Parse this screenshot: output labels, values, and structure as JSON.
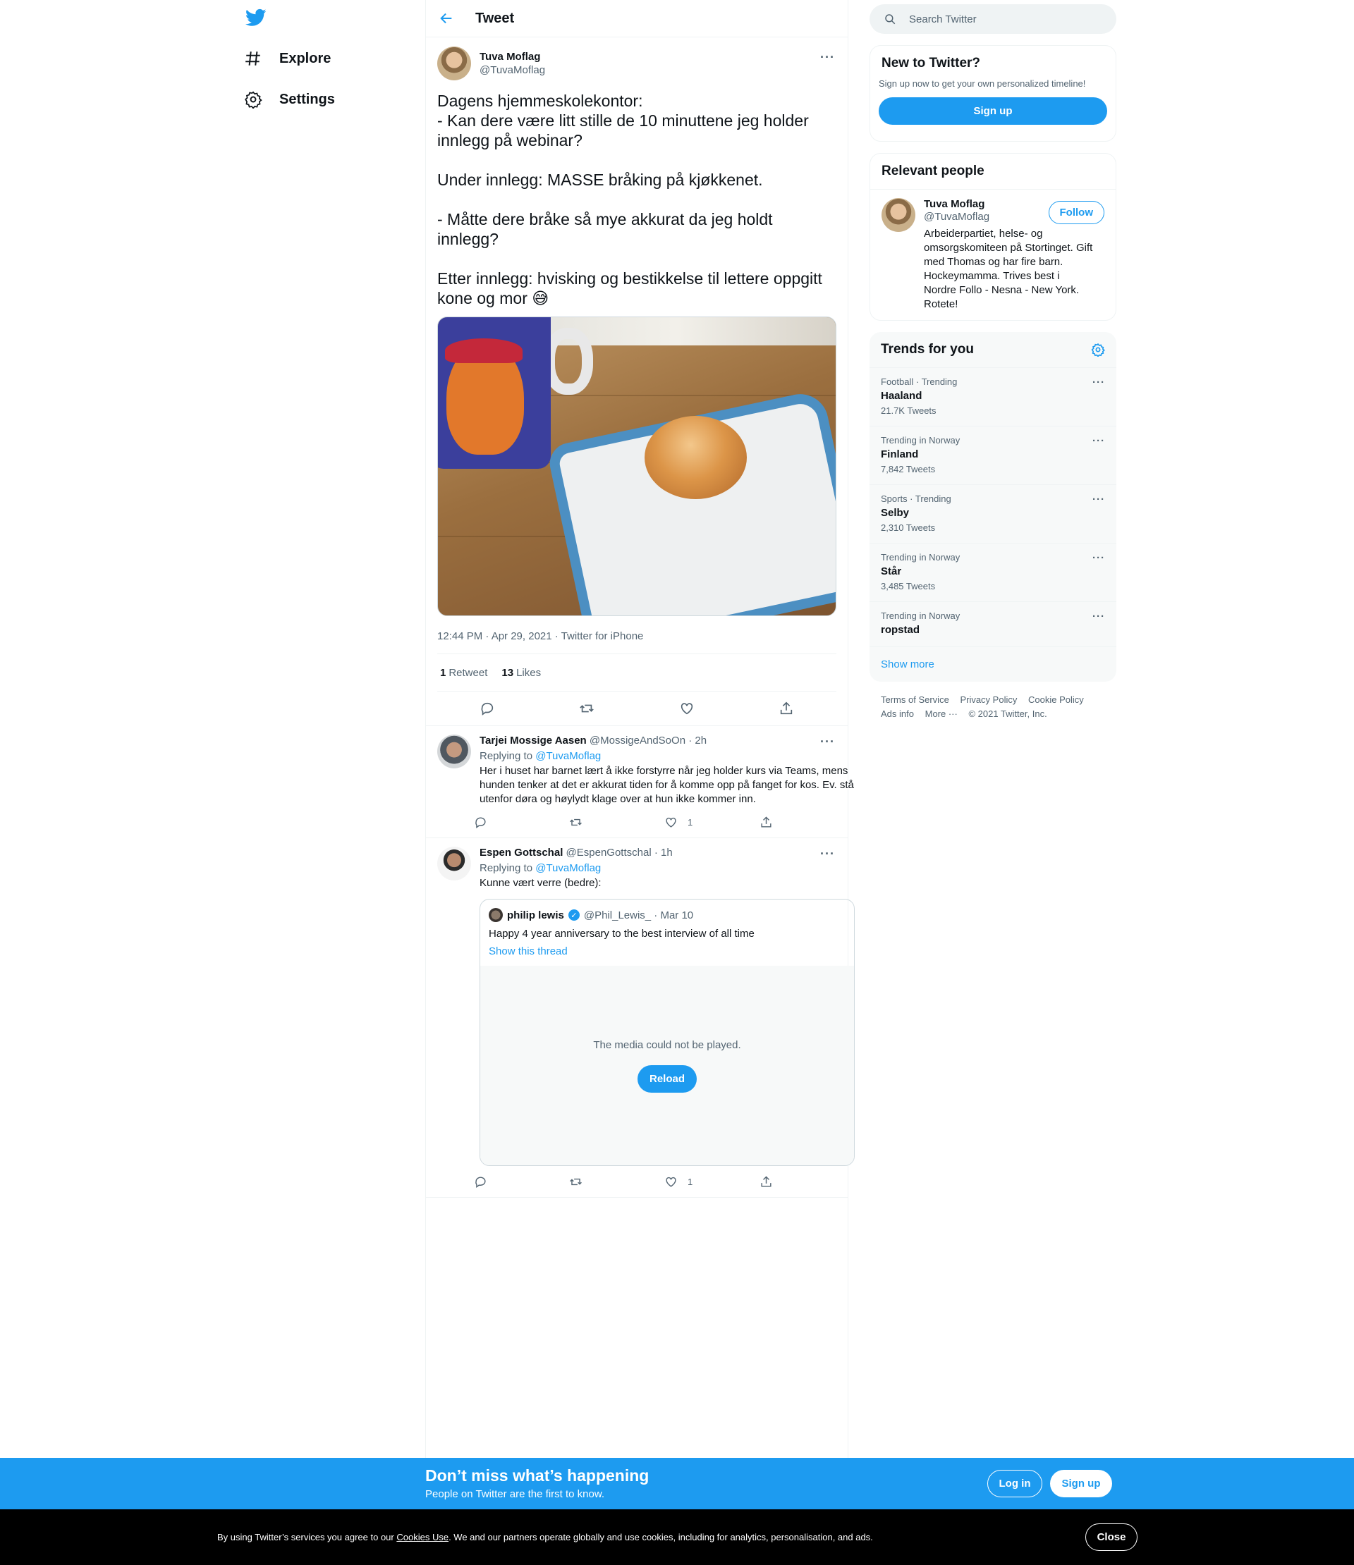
{
  "nav": {
    "explore_label": "Explore",
    "settings_label": "Settings"
  },
  "header": {
    "title": "Tweet"
  },
  "tweet": {
    "author_name": "Tuva Moflag",
    "author_handle": "@TuvaMoflag",
    "text": "Dagens hjemmeskolekontor:\n- Kan dere være litt stille de 10 minuttene jeg holder innlegg på webinar?\n\nUnder innlegg: MASSE bråking på kjøkkenet.\n\n- Måtte dere bråke så mye akkurat da jeg holdt innlegg?\n\nEtter innlegg: hvisking og bestikkelse til lettere oppgitt kone og mor 😅",
    "meta": "12:44 PM · Apr 29, 2021 · Twitter for iPhone",
    "retweet_count": "1",
    "retweet_label": "Retweet",
    "like_count": "13",
    "like_label": "Likes"
  },
  "replies": [
    {
      "name": "Tarjei Mossige Aasen",
      "handle_time": "@MossigeAndSoOn · 2h",
      "replying_prefix": "Replying to ",
      "replying_to": "@TuvaMoflag",
      "text": "Her i huset har barnet lært å ikke forstyrre når jeg holder kurs via Teams, mens hunden tenker at det er akkurat tiden for å komme opp på fanget for kos. Ev. stå utenfor døra og høylydt klage over at hun ikke kommer inn.",
      "like_count": "1"
    },
    {
      "name": "Espen Gottschal",
      "handle_time": "@EspenGottschal · 1h",
      "replying_prefix": "Replying to ",
      "replying_to": "@TuvaMoflag",
      "text": "Kunne vært verre (bedre):",
      "like_count": "1",
      "quote": {
        "name": "philip lewis",
        "handle_time": "@Phil_Lewis_ · Mar 10",
        "text": "Happy 4 year anniversary to the best interview of all time",
        "link": "Show this thread",
        "media_message": "The media could not be played.",
        "reload_label": "Reload"
      }
    }
  ],
  "sidebar": {
    "search_placeholder": "Search Twitter",
    "new_title": "New to Twitter?",
    "new_subtitle": "Sign up now to get your own personalized timeline!",
    "signup_label": "Sign up",
    "relevant_title": "Relevant people",
    "person": {
      "name": "Tuva Moflag",
      "handle": "@TuvaMoflag",
      "bio": "Arbeiderpartiet, helse- og omsorgskomiteen på Stortinget. Gift med Thomas og har fire barn. Hockeymamma. Trives best i Nordre Follo - Nesna - New York. Rotete!",
      "follow_label": "Follow"
    },
    "trends_title": "Trends for you",
    "trends": [
      {
        "context": "Football · Trending",
        "name": "Haaland",
        "count": "21.7K Tweets"
      },
      {
        "context": "Trending in Norway",
        "name": "Finland",
        "count": "7,842 Tweets"
      },
      {
        "context": "Sports · Trending",
        "name": "Selby",
        "count": "2,310 Tweets"
      },
      {
        "context": "Trending in Norway",
        "name": "Står",
        "count": "3,485 Tweets"
      },
      {
        "context": "Trending in Norway",
        "name": "ropstad",
        "count": ""
      }
    ],
    "show_more": "Show more",
    "footer": {
      "terms": "Terms of Service",
      "privacy": "Privacy Policy",
      "cookie": "Cookie Policy",
      "ads": "Ads info",
      "more": "More ···",
      "copyright": "© 2021 Twitter, Inc."
    }
  },
  "bottom_bar": {
    "headline": "Don’t miss what’s happening",
    "subline": "People on Twitter are the first to know.",
    "login_label": "Log in",
    "signup_label": "Sign up"
  },
  "cookie_bar": {
    "text_before": "By using Twitter’s services you agree to our ",
    "link": "Cookies Use",
    "text_after": ". We and our partners operate globally and use cookies, including for analytics, personalisation, and ads.",
    "close_label": "Close"
  },
  "colors": {
    "accent": "#1d9bf0",
    "text": "#0f1419",
    "muted": "#536471"
  }
}
